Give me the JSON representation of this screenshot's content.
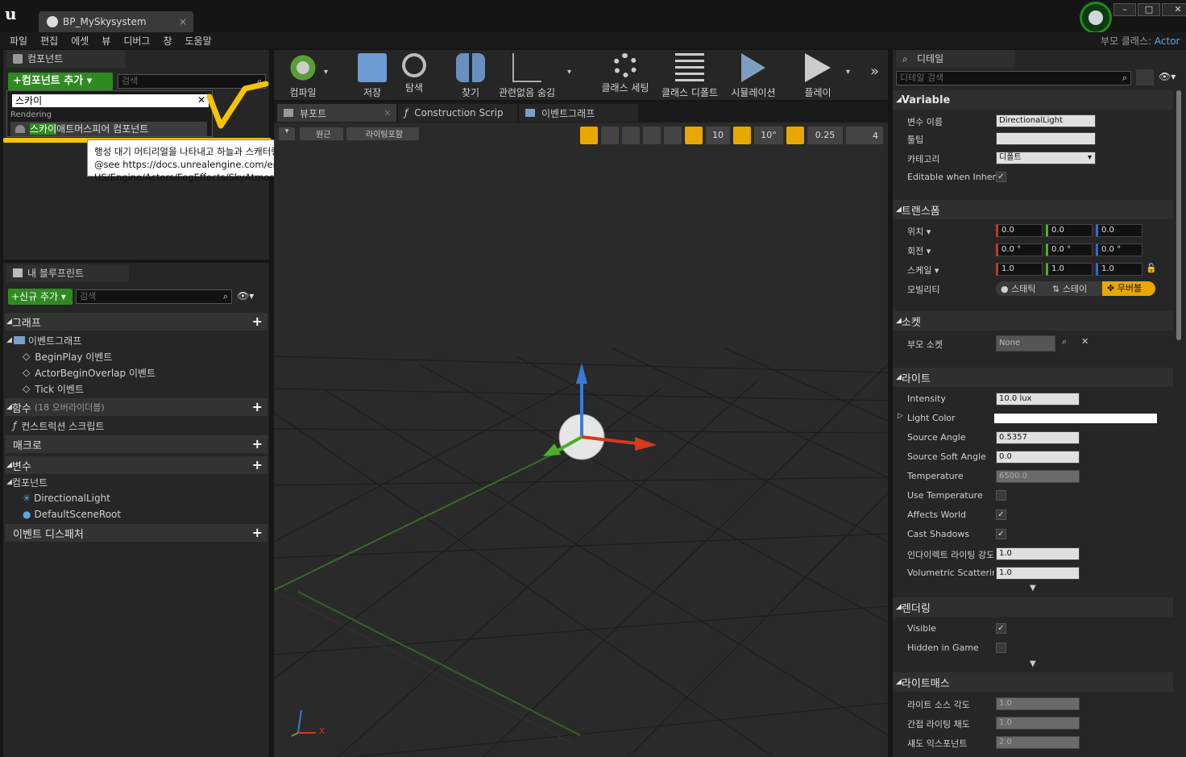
{
  "window": {
    "tab_title": "BP_MySkysystem",
    "parent_class_label": "부모 클래스:",
    "parent_class_value": "Actor"
  },
  "menu": [
    "파일",
    "편집",
    "에셋",
    "뷰",
    "디버그",
    "창",
    "도움말"
  ],
  "components_panel": {
    "tab_label": "컴포넌트",
    "add_button": "+컴포넌트 추가",
    "search_placeholder": "검색",
    "filter_value": "스카이",
    "category": "Rendering",
    "result_highlight": "스카이",
    "result_rest": "애트머스피어 컴포넌트"
  },
  "tooltip": {
    "line1": "행성 대기 머티리얼을 나타내고 하늘과 스캐터링 라이트를 시뮬레이션하는 컴포넌트입니다.",
    "line2": "@see https://docs.unrealengine.com/en-US/Engine/Actors/FogEffects/SkyAtmosphere/index.html"
  },
  "blueprint_panel": {
    "tab_label": "내 블루프린트",
    "add_button": "+신규 추가",
    "search_placeholder": "검색",
    "graph_header": "그래프",
    "event_graph": "이벤트그래프",
    "events": [
      "BeginPlay 이벤트",
      "ActorBeginOverlap 이벤트",
      "Tick 이벤트"
    ],
    "functions_header": "함수",
    "functions_note": "(18 오버라이더블)",
    "construction_script": "컨스트럭션 스크립트",
    "macros_header": "매크로",
    "variables_header": "변수",
    "components_header": "컴포넌트",
    "components": [
      "DirectionalLight",
      "DefaultSceneRoot"
    ],
    "dispatchers_header": "이벤트 디스패처"
  },
  "toolbar": {
    "tools": [
      "컴파일",
      "저장",
      "탐색",
      "찾기",
      "관련없음 숨김",
      "클래스 세팅",
      "클래스 디폴트",
      "시뮬레이션",
      "플레이"
    ]
  },
  "editor_tabs": [
    "뷰포트",
    "Construction Scrip",
    "이벤트그래프"
  ],
  "viewport": {
    "btn1": "원근",
    "btn2": "라이팅포함",
    "grid_snap": "10",
    "rot_snap": "10°",
    "scale_snap": "0.25",
    "cam_speed": "4",
    "axis_x": "X"
  },
  "details": {
    "tab_label": "디테일",
    "search_placeholder": "디테일 검색",
    "variable_section": "Variable",
    "var_name_label": "변수 이름",
    "var_name_value": "DirectionalLight",
    "tooltip_label": "툴팁",
    "category_label": "카테고리",
    "category_value": "디폴트",
    "editable_label": "Editable when Inherit",
    "transform_section": "트랜스폼",
    "location_label": "위치",
    "location": [
      "0.0",
      "0.0",
      "0.0"
    ],
    "rotation_label": "회전",
    "rotation": [
      "0.0 °",
      "0.0 °",
      "0.0 °"
    ],
    "scale_label": "스케일",
    "scale": [
      "1.0",
      "1.0",
      "1.0"
    ],
    "mobility_label": "모빌리티",
    "mobility_options": [
      "스태틱",
      "스테이",
      "무버블"
    ],
    "socket_section": "소켓",
    "parent_socket_label": "부모 소켓",
    "parent_socket_value": "None",
    "light_section": "라이트",
    "intensity_label": "Intensity",
    "intensity_value": "10.0 lux",
    "light_color_label": "Light Color",
    "source_angle_label": "Source Angle",
    "source_angle_value": "0.5357",
    "source_soft_angle_label": "Source Soft Angle",
    "source_soft_angle_value": "0.0",
    "temperature_label": "Temperature",
    "temperature_value": "6500.0",
    "use_temperature_label": "Use Temperature",
    "affects_world_label": "Affects World",
    "cast_shadows_label": "Cast Shadows",
    "indirect_label": "인다이렉트 라이팅 강도",
    "indirect_value": "1.0",
    "volumetric_label": "Volumetric Scatterin",
    "volumetric_value": "1.0",
    "rendering_section": "렌더링",
    "visible_label": "Visible",
    "hidden_label": "Hidden in Game",
    "lightmass_section": "라이트매스",
    "lm_source_angle_label": "라이트 소스 각도",
    "lm_source_angle_value": "1.0",
    "lm_indirect_sat_label": "간접 라이팅 채도",
    "lm_indirect_sat_value": "1.0",
    "lm_shadow_exp_label": "섀도 익스포넌트",
    "lm_shadow_exp_value": "2.0"
  },
  "colors": {
    "accent_green": "#2e8b20",
    "highlight_yellow": "#f5c400",
    "link_blue": "#5aa7e8"
  }
}
